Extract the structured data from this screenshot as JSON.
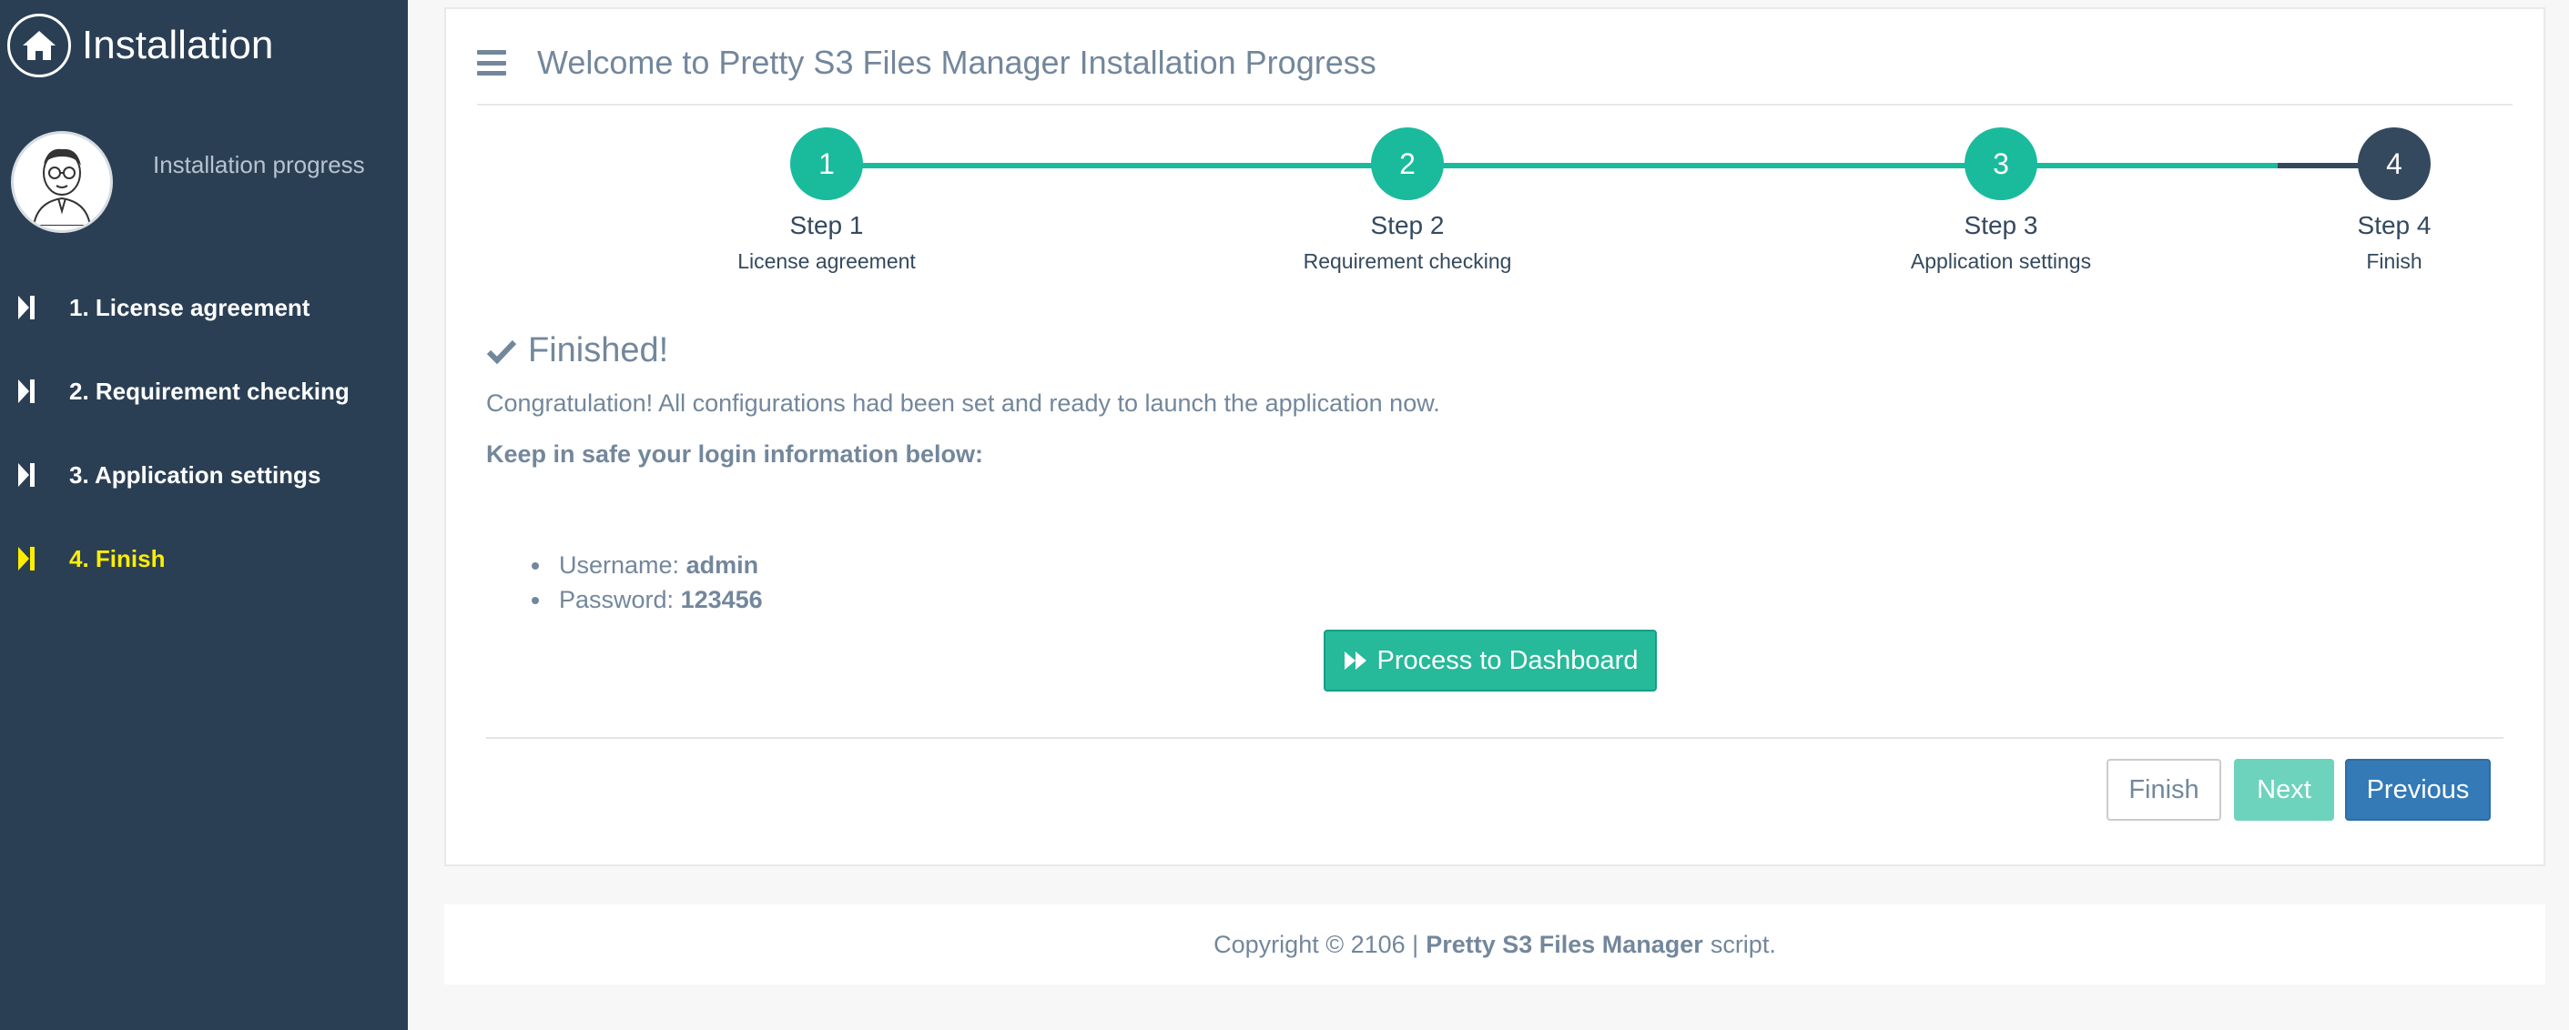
{
  "sidebar": {
    "brand_title": "Installation",
    "profile_text": "Installation progress",
    "items": [
      {
        "label": "1. License agreement"
      },
      {
        "label": "2. Requirement checking"
      },
      {
        "label": "3. Application settings"
      },
      {
        "label": "4. Finish"
      }
    ],
    "active_index": 3
  },
  "header": {
    "title": "Welcome to Pretty S3 Files Manager Installation Progress"
  },
  "wizard": {
    "steps": [
      {
        "number": "1",
        "label": "Step 1",
        "sub": "License agreement"
      },
      {
        "number": "2",
        "label": "Step 2",
        "sub": "Requirement checking"
      },
      {
        "number": "3",
        "label": "Step 3",
        "sub": "Application settings"
      },
      {
        "number": "4",
        "label": "Step 4",
        "sub": "Finish"
      }
    ],
    "current_step": 4
  },
  "content": {
    "finished_title": "Finished!",
    "congrats": "Congratulation! All configurations had been set and ready to launch the application now.",
    "keep_safe": "Keep in safe your login information below:",
    "username_label": "Username:",
    "username_value": "admin",
    "password_label": "Password:",
    "password_value": "123456",
    "dashboard_button": "Process to Dashboard"
  },
  "actions": {
    "finish": "Finish",
    "next": "Next",
    "previous": "Previous"
  },
  "footer": {
    "prefix": "Copyright © 2106 |",
    "product": "Pretty S3 Files Manager",
    "suffix": "script."
  },
  "colors": {
    "sidebar_bg": "#2a3f54",
    "accent_green": "#1abb9c",
    "current_step": "#34495e",
    "active_menu": "#ffee00",
    "primary_blue": "#337ab7"
  },
  "icons": {
    "brand": "home-icon",
    "menu": "step-forward-icon",
    "header": "bars-icon",
    "finished": "check-icon",
    "dashboard": "fast-forward-icon"
  }
}
